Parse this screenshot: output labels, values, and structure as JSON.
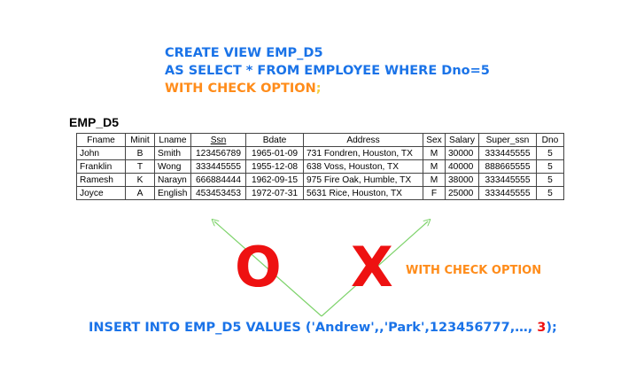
{
  "sql": {
    "line1": "CREATE VIEW EMP_D5",
    "line2": "AS SELECT * FROM EMPLOYEE WHERE Dno=5",
    "line3": "WITH CHECK OPTION",
    "line3_end": ";"
  },
  "table": {
    "name": "EMP_D5",
    "columns": [
      "Fname",
      "Minit",
      "Lname",
      "Ssn",
      "Bdate",
      "Address",
      "Sex",
      "Salary",
      "Super_ssn",
      "Dno"
    ],
    "rows": [
      [
        "John",
        "B",
        "Smith",
        "123456789",
        "1965-01-09",
        "731 Fondren, Houston, TX",
        "M",
        "30000",
        "333445555",
        "5"
      ],
      [
        "Franklin",
        "T",
        "Wong",
        "333445555",
        "1955-12-08",
        "638 Voss, Houston, TX",
        "M",
        "40000",
        "888665555",
        "5"
      ],
      [
        "Ramesh",
        "K",
        "Narayn",
        "666884444",
        "1962-09-15",
        "975 Fire Oak, Humble, TX",
        "M",
        "38000",
        "333445555",
        "5"
      ],
      [
        "Joyce",
        "A",
        "English",
        "453453453",
        "1972-07-31",
        "5631 Rice, Houston, TX",
        "F",
        "25000",
        "333445555",
        "5"
      ]
    ]
  },
  "marks": {
    "o": "O",
    "x": "X",
    "label": "WITH CHECK OPTION"
  },
  "insert": {
    "prefix": "INSERT INTO EMP_D5 VALUES ('Andrew',,'Park',123456777,…, ",
    "highlight": "3",
    "suffix": ");"
  },
  "colors": {
    "blue": "#1a73e8",
    "orange": "#ff8c1a",
    "red": "#ee1111",
    "green": "#7ed36b"
  }
}
